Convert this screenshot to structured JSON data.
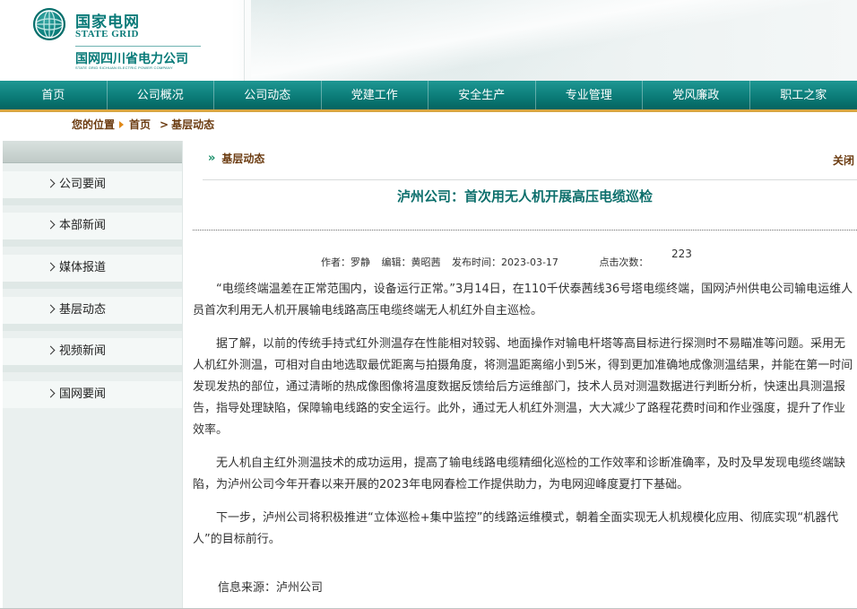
{
  "header": {
    "logo_cn": "国家电网",
    "logo_en": "State Grid",
    "company_cn": "国网四川省电力公司",
    "company_en": "STATE GRID SICHUAN ELECTRIC POWER COMPANY"
  },
  "nav": {
    "items": [
      "首页",
      "公司概况",
      "公司动态",
      "党建工作",
      "安全生产",
      "专业管理",
      "党风廉政",
      "职工之家"
    ]
  },
  "breadcrumb": {
    "label": "您的位置",
    "home": "首页",
    "current": "基层动态",
    "sep": ">"
  },
  "sidebar": {
    "items": [
      "公司要闻",
      "本部新闻",
      "媒体报道",
      "基层动态",
      "视频新闻",
      "国网要闻"
    ]
  },
  "section": {
    "heading": "基层动态",
    "close": "关闭"
  },
  "article": {
    "title": "泸州公司：首次用无人机开展高压电缆巡检",
    "author": "作者：罗静",
    "editor": "编辑：黄昭茜",
    "date": "发布时间：2023-03-17",
    "hits_label": "点击次数：",
    "hits": "223",
    "paragraphs": [
      "“电缆终端温差在正常范围内，设备运行正常。”3月14日，在110千伏泰茜线36号塔电缆终端，国网泸州供电公司输电运维人员首次利用无人机开展输电线路高压电缆终端无人机红外自主巡检。",
      "据了解，以前的传统手持式红外测温存在性能相对较弱、地面操作对输电杆塔等高目标进行探测时不易瞄准等问题。采用无人机红外测温，可相对自由地选取最优距离与拍摄角度，将测温距离缩小到5米，得到更加准确地成像测温结果，并能在第一时间发现发热的部位，通过清晰的热成像图像将温度数据反馈给后方运维部门，技术人员对测温数据进行判断分析，快速出具测温报告，指导处理缺陷，保障输电线路的安全运行。此外，通过无人机红外测温，大大减少了路程花费时间和作业强度，提升了作业效率。",
      "无人机自主红外测温技术的成功运用，提高了输电线路电缆精细化巡检的工作效率和诊断准确率，及时及早发现电缆终端缺陷，为泸州公司今年开春以来开展的2023年电网春检工作提供助力，为电网迎峰度夏打下基础。",
      "下一步，泸州公司将积极推进“立体巡检+集中监控”的线路运维模式，朝着全面实现无人机规模化应用、彻底实现“机器代人”的目标前行。"
    ],
    "source": "信息来源：泸州公司"
  }
}
